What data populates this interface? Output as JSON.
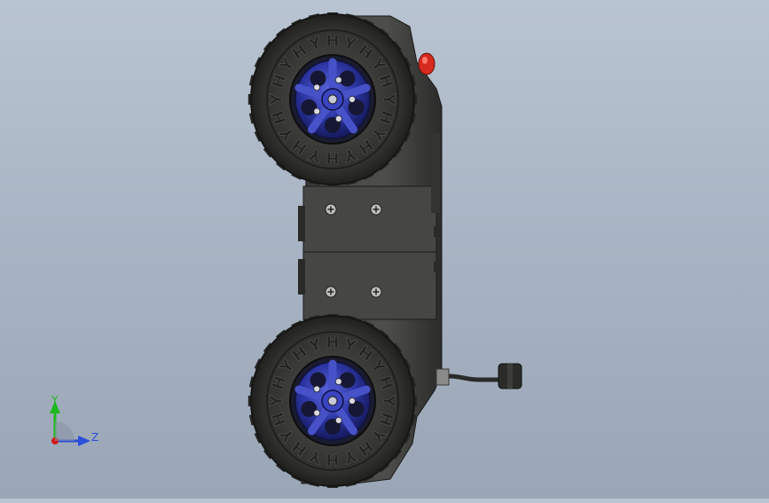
{
  "view": {
    "background_top": "#b9c4d2",
    "background_bottom": "#9aa6b6",
    "model": {
      "body_color": "#3e3f3c",
      "tire_color": "#2c2d2b",
      "rim_color": "#2d36a6",
      "button_color": "#d62a1f",
      "tread_letter": "Y",
      "tread_letter_alt": "H"
    },
    "triad": {
      "y_label": "Y",
      "z_label": "Z",
      "y_color": "#1db81d",
      "z_color": "#2a4fd8",
      "x_color": "#d01919"
    }
  }
}
